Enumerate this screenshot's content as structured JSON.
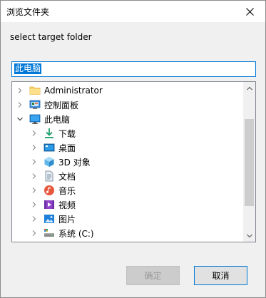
{
  "window": {
    "title": "浏览文件夹"
  },
  "prompt": "select target folder",
  "path_value": "此电脑",
  "tree": [
    {
      "label": "Administrator",
      "icon": "folder-icon",
      "depth": 0,
      "expander": "collapsed"
    },
    {
      "label": "控制面板",
      "icon": "control-panel-icon",
      "depth": 0,
      "expander": "collapsed"
    },
    {
      "label": "此电脑",
      "icon": "this-pc-icon",
      "depth": 0,
      "expander": "expanded"
    },
    {
      "label": "下载",
      "icon": "download-icon",
      "depth": 1,
      "expander": "collapsed"
    },
    {
      "label": "桌面",
      "icon": "desktop-icon",
      "depth": 1,
      "expander": "collapsed"
    },
    {
      "label": "3D 对象",
      "icon": "3d-objects-icon",
      "depth": 1,
      "expander": "collapsed"
    },
    {
      "label": "文档",
      "icon": "documents-icon",
      "depth": 1,
      "expander": "collapsed"
    },
    {
      "label": "音乐",
      "icon": "music-icon",
      "depth": 1,
      "expander": "collapsed"
    },
    {
      "label": "视频",
      "icon": "videos-icon",
      "depth": 1,
      "expander": "collapsed"
    },
    {
      "label": "图片",
      "icon": "pictures-icon",
      "depth": 1,
      "expander": "collapsed"
    },
    {
      "label": "系统 (C:)",
      "icon": "drive-icon",
      "depth": 1,
      "expander": "collapsed"
    }
  ],
  "buttons": {
    "ok": "确定",
    "cancel": "取消"
  },
  "colors": {
    "accent": "#0078d7",
    "folder": "#f8d775"
  }
}
